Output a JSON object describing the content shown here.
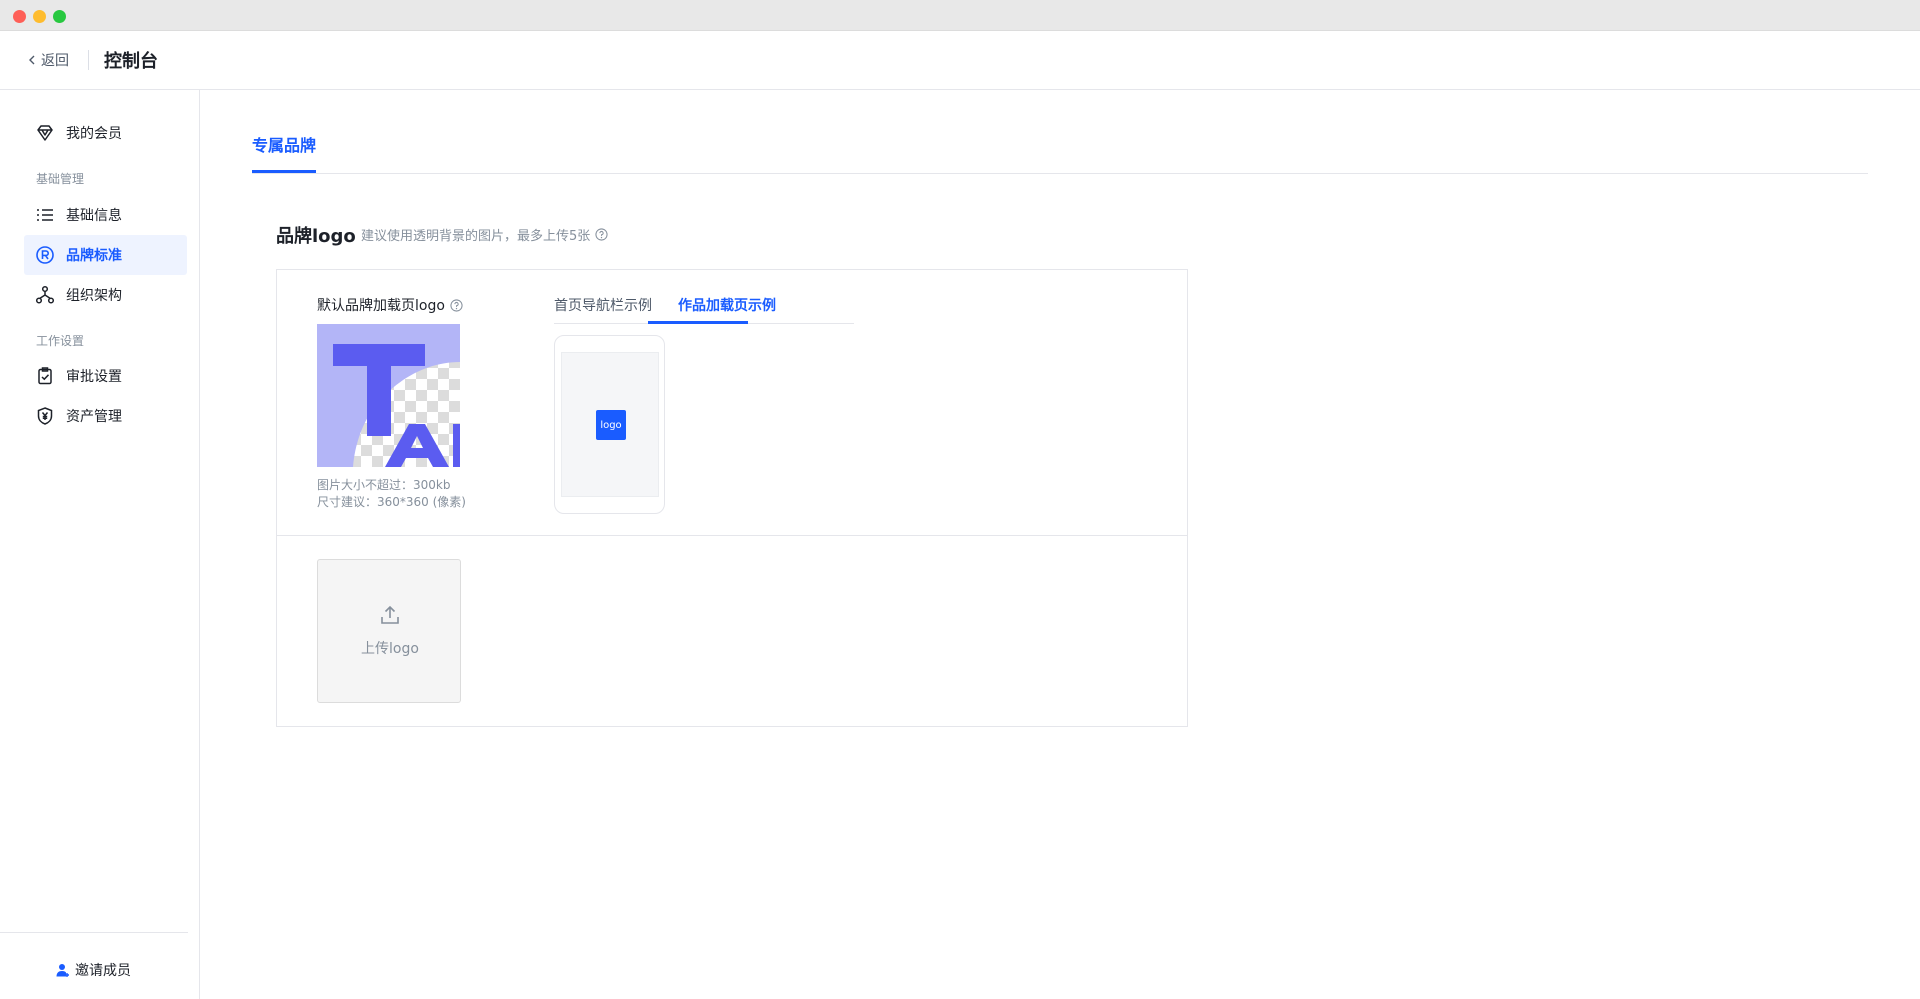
{
  "header": {
    "back_label": "返回",
    "title": "控制台"
  },
  "sidebar": {
    "items": [
      {
        "label": "我的会员",
        "icon": "diamond-icon"
      },
      {
        "group": "基础管理"
      },
      {
        "label": "基础信息",
        "icon": "list-icon"
      },
      {
        "label": "品牌标准",
        "icon": "registered-icon",
        "active": true
      },
      {
        "label": "组织架构",
        "icon": "org-chart-icon"
      },
      {
        "group": "工作设置"
      },
      {
        "label": "审批设置",
        "icon": "clipboard-check-icon"
      },
      {
        "label": "资产管理",
        "icon": "yen-shield-icon"
      }
    ],
    "invite_label": "邀请成员"
  },
  "main": {
    "tab": "专属品牌",
    "section_title": "品牌logo",
    "section_hint": "建议使用透明背景的图片，最多上传5张",
    "default_logo_label": "默认品牌加载页logo",
    "size_note_1": "图片大小不超过：300kb",
    "size_note_2": "尺寸建议：360*360 (像素)",
    "example_tabs": [
      "首页导航栏示例",
      "作品加载页示例"
    ],
    "active_example_tab": "作品加载页示例",
    "phone_logo_text": "logo",
    "upload_label": "上传logo"
  },
  "colors": {
    "accent": "#1a5cff",
    "logo_purple": "#5b5cf0",
    "logo_bg": "#b3b5f7"
  }
}
